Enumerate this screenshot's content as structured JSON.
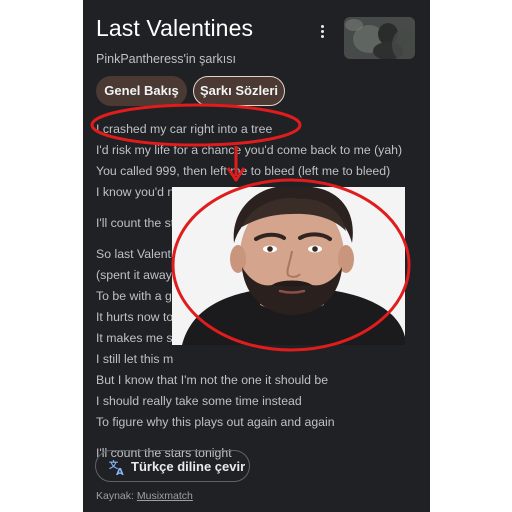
{
  "song": {
    "title": "Last Valentines",
    "subtitle": "PinkPantheress'in şarkısı"
  },
  "tabs": [
    {
      "label": "Genel Bakış"
    },
    {
      "label": "Şarkı Sözleri",
      "selected": true
    }
  ],
  "icons": {
    "more": "more-vert-icon",
    "translate": "translate-icon"
  },
  "lyrics": {
    "lines": [
      "I crashed my car right into a tree",
      "I'd risk my life for a chance you'd come back to me (yah)",
      "You called 999, then left me to bleed (left me to bleed)",
      "I know you'd never cause an accident for me",
      "I'll count the stars tonight",
      "So last Valentines",
      "(spent it away",
      "To be with a g",
      "It hurts now to",
      "It makes me sa",
      "I still let this m",
      "But I know that I'm not the one it should be",
      "I should really take some time instead",
      "To figure why this plays out again and again",
      "I'll count the stars tonight"
    ]
  },
  "translate_button": {
    "label": "Türkçe diline çevir"
  },
  "source": {
    "prefix": "Kaynak: ",
    "link": "Musixmatch"
  },
  "colors": {
    "panel_background": "#202124",
    "chip_background": "#4a3a33",
    "annotation_red": "#e01c1c",
    "translate_icon_blue": "#8ab4f8"
  }
}
